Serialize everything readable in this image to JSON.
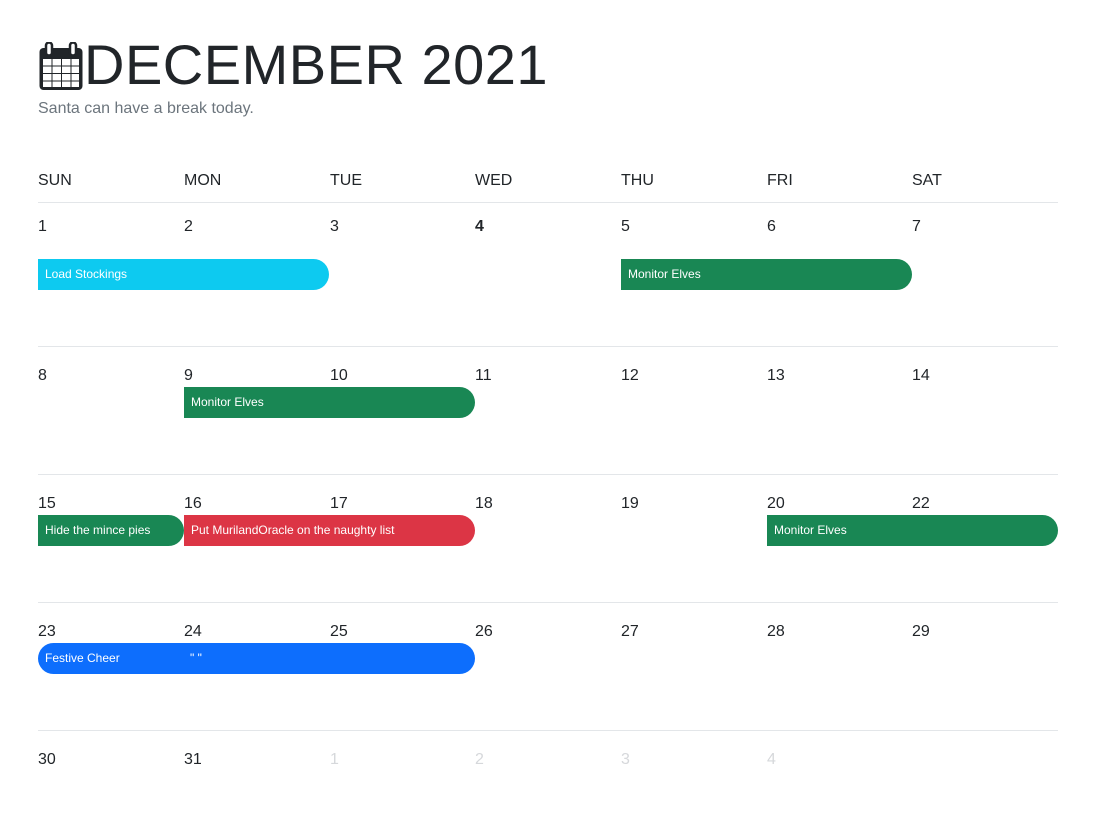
{
  "header": {
    "icon": "calendar-icon",
    "title": "DECEMBER 2021",
    "subtitle": "Santa can have a break today."
  },
  "weekdays": [
    "SUN",
    "MON",
    "TUE",
    "WED",
    "THU",
    "FRI",
    "SAT"
  ],
  "weeks": [
    {
      "days": [
        "1",
        "2",
        "3",
        "4",
        "5",
        "6",
        "7"
      ],
      "events": {
        "load_stockings": "Load Stockings",
        "monitor_elves": "Monitor Elves"
      }
    },
    {
      "days": [
        "8",
        "9",
        "10",
        "11",
        "12",
        "13",
        "14"
      ],
      "events": {
        "monitor_elves": "Monitor Elves"
      }
    },
    {
      "days": [
        "15",
        "16",
        "17",
        "18",
        "19",
        "20",
        "22"
      ],
      "events": {
        "hide_pies": "Hide the mince pies",
        "naughty_list": "Put MurilandOracle on the naughty list",
        "monitor_elves": "Monitor Elves"
      }
    },
    {
      "days": [
        "23",
        "24",
        "25",
        "26",
        "27",
        "28",
        "29"
      ],
      "events": {
        "festive_cheer": "Festive Cheer",
        "festive_cheer_extra": "\" \""
      }
    },
    {
      "days": [
        "30",
        "31",
        "1",
        "2",
        "3",
        "4"
      ]
    }
  ],
  "today": "4",
  "colors": {
    "info": "#0dcaf0",
    "success": "#198754",
    "danger": "#dc3545",
    "primary": "#0d6efd",
    "muted_day": "#d6d8db",
    "subtitle": "#6c757d"
  }
}
